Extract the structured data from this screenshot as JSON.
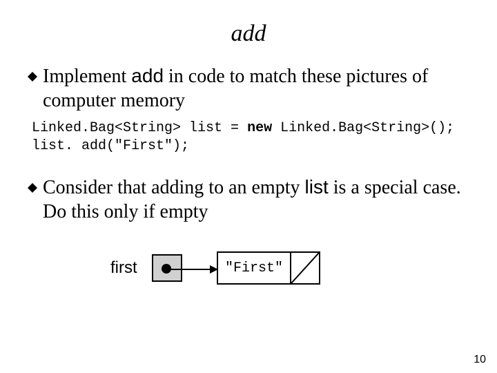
{
  "title": "add",
  "bullets": [
    {
      "pre": "Implement ",
      "code": "add",
      "post": " in code to match these pictures of computer memory"
    },
    {
      "pre": "Consider that adding to an empty ",
      "code": "list",
      "post": " is a special case. Do this only if empty"
    }
  ],
  "code": {
    "line1_pre": "Linked.Bag<String> list = ",
    "line1_kw": "new",
    "line1_post": " Linked.Bag<String>();",
    "line2": "list. add(\"First\");"
  },
  "diagram": {
    "first_label": "first",
    "node_value": "\"First\""
  },
  "slide_number": "10"
}
